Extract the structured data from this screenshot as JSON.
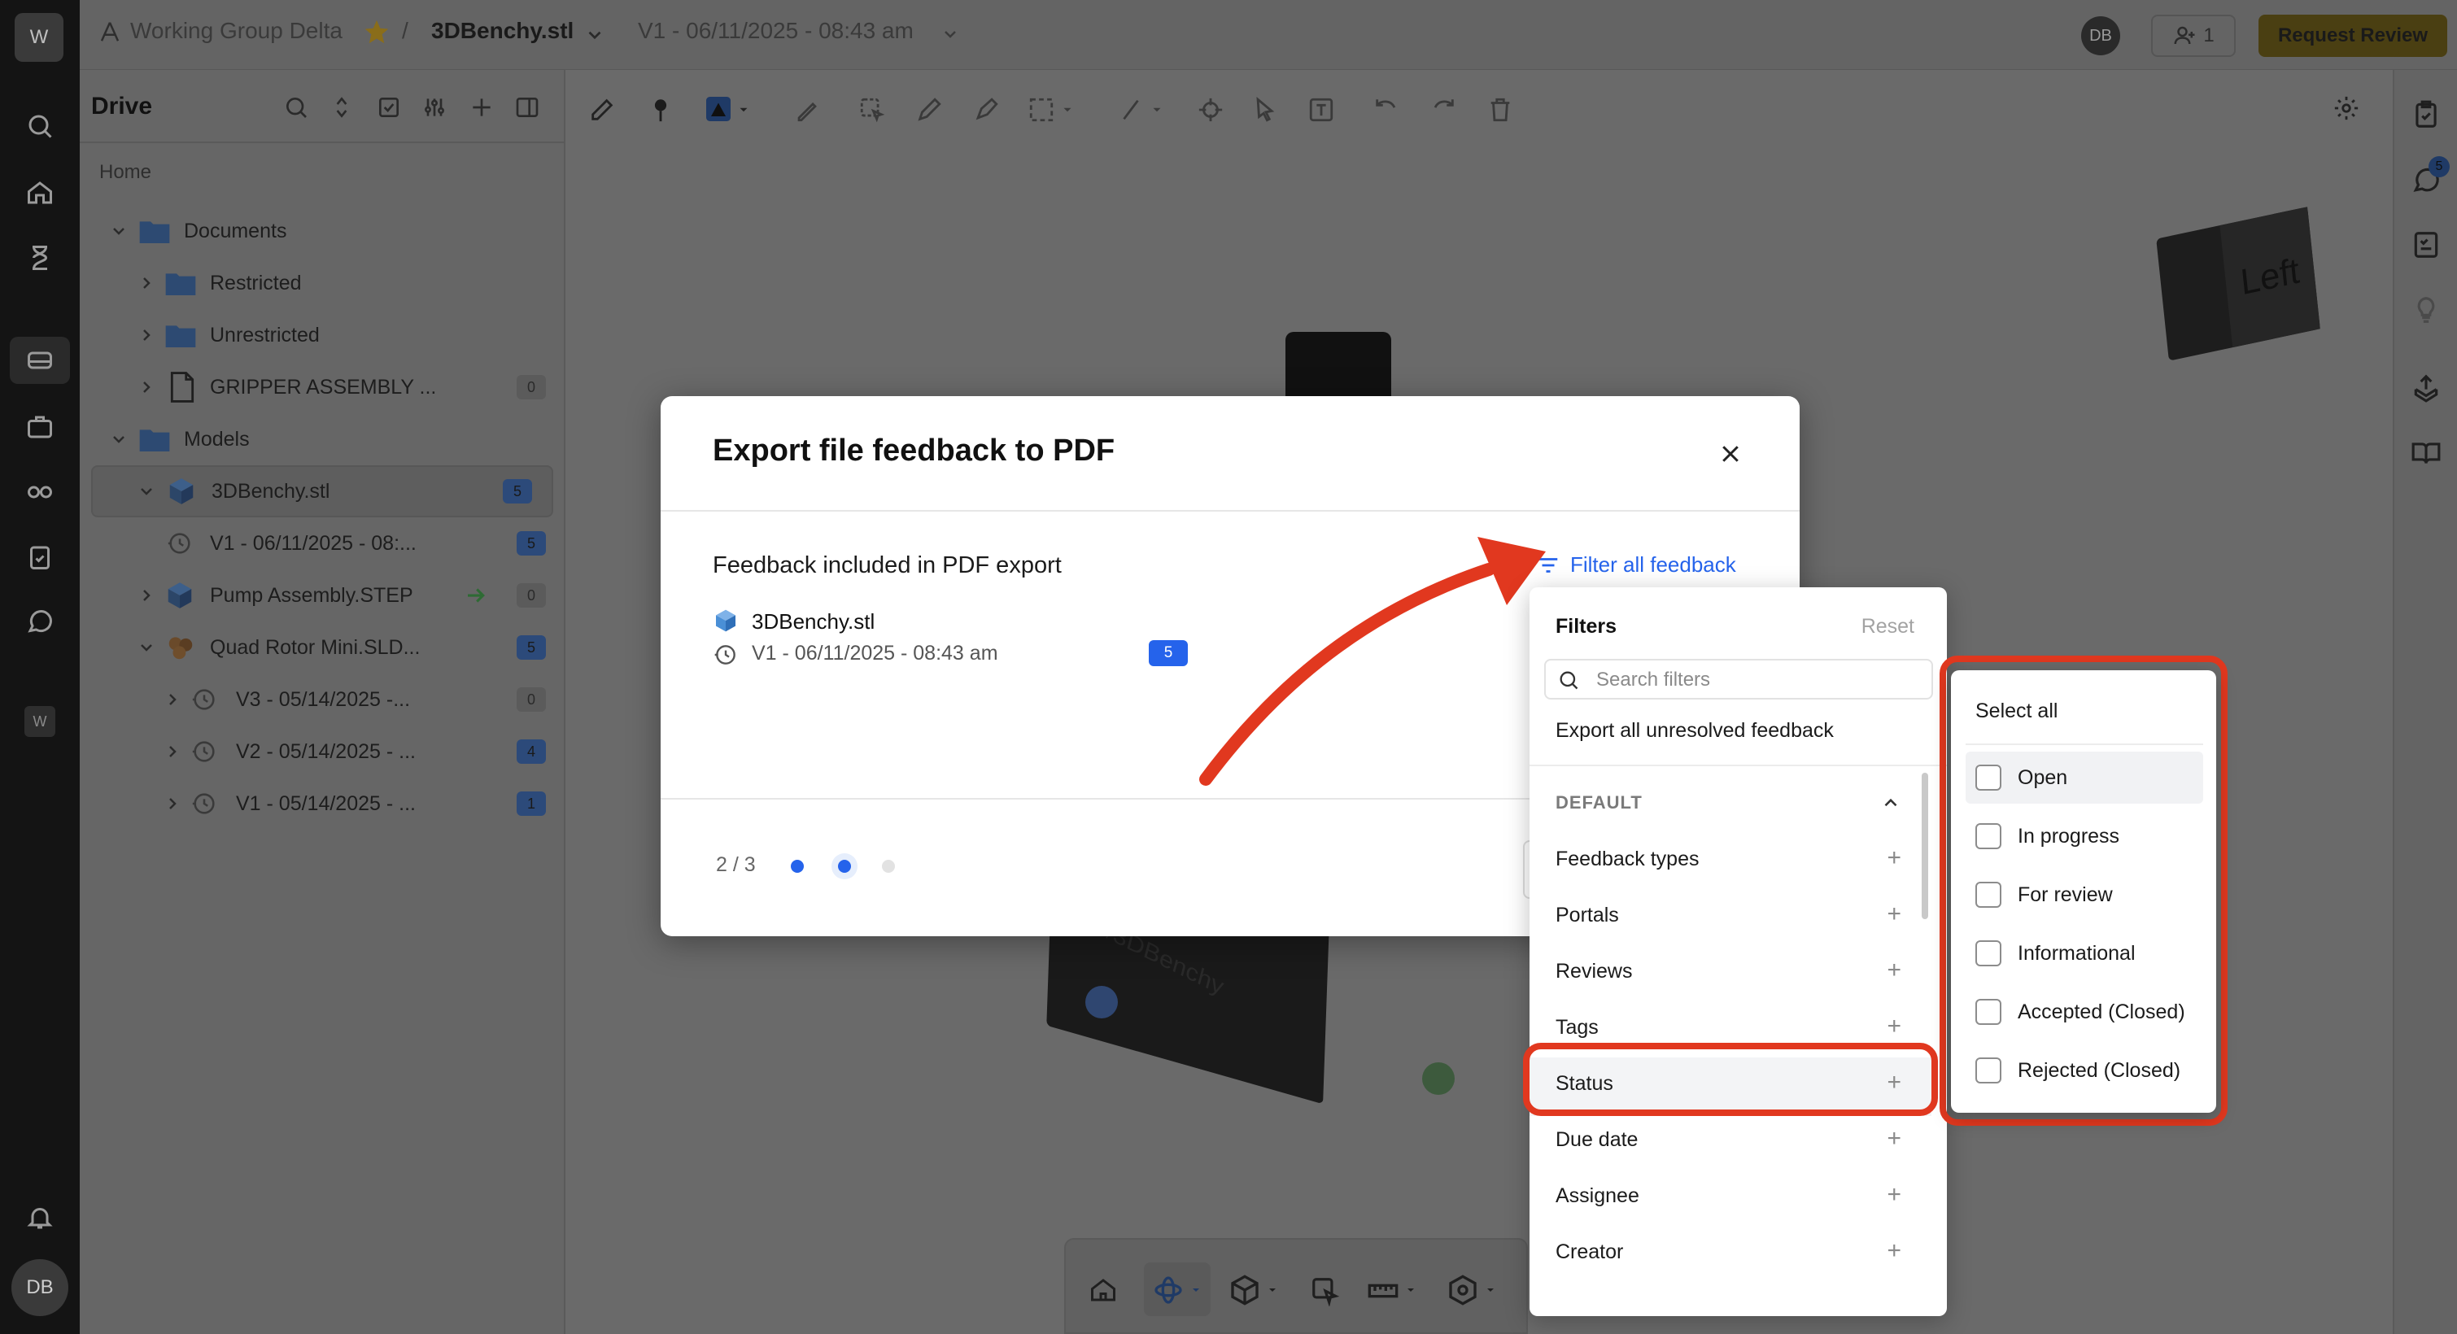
{
  "rail": {
    "workspace_initial": "W",
    "mini_workspace": "W",
    "user_initials": "DB"
  },
  "topbar": {
    "workspace": "Working Group Delta",
    "separator": "/",
    "file": "3DBenchy.stl",
    "version": "V1 - 06/11/2025 - 08:43 am",
    "user_initials": "DB",
    "members_count": "1",
    "request_review": "Request Review"
  },
  "drive": {
    "title": "Drive",
    "breadcrumb": "Home",
    "items": [
      {
        "label": "Documents"
      },
      {
        "label": "Restricted"
      },
      {
        "label": "Unrestricted"
      },
      {
        "label": "GRIPPER ASSEMBLY ...",
        "count": "0"
      },
      {
        "label": "Models"
      },
      {
        "label": "3DBenchy.stl",
        "count": "5"
      },
      {
        "label": "V1 - 06/11/2025 - 08:...",
        "count": "5"
      },
      {
        "label": "Pump Assembly.STEP",
        "count": "0"
      },
      {
        "label": "Quad Rotor Mini.SLD...",
        "count": "5"
      },
      {
        "label": "V3 - 05/14/2025 -...",
        "count": "0"
      },
      {
        "label": "V2 - 05/14/2025 - ...",
        "count": "4"
      },
      {
        "label": "V1 - 05/14/2025 - ...",
        "count": "1"
      }
    ]
  },
  "viewer": {
    "cube_label": "Left",
    "model_text": "#3DBenchy",
    "comments_badge": "5"
  },
  "modal": {
    "title": "Export file feedback to PDF",
    "section_label": "Feedback included in PDF export",
    "filter_link": "Filter all feedback",
    "file_name": "3DBenchy.stl",
    "version": "V1 - 06/11/2025 - 08:43 am",
    "version_count": "5",
    "step": "2 / 3"
  },
  "filters": {
    "title": "Filters",
    "reset": "Reset",
    "search_placeholder": "Search filters",
    "export_unresolved": "Export all unresolved feedback",
    "section": "DEFAULT",
    "items": [
      "Feedback types",
      "Portals",
      "Reviews",
      "Tags",
      "Status",
      "Due date",
      "Assignee",
      "Creator"
    ]
  },
  "status_panel": {
    "select_all": "Select all",
    "options": [
      "Open",
      "In progress",
      "For review",
      "Informational",
      "Accepted (Closed)",
      "Rejected (Closed)"
    ]
  },
  "colors": {
    "accent_blue": "#2563eb",
    "annotation_red": "#e1381f",
    "request_review_bg": "#4a3f12"
  }
}
